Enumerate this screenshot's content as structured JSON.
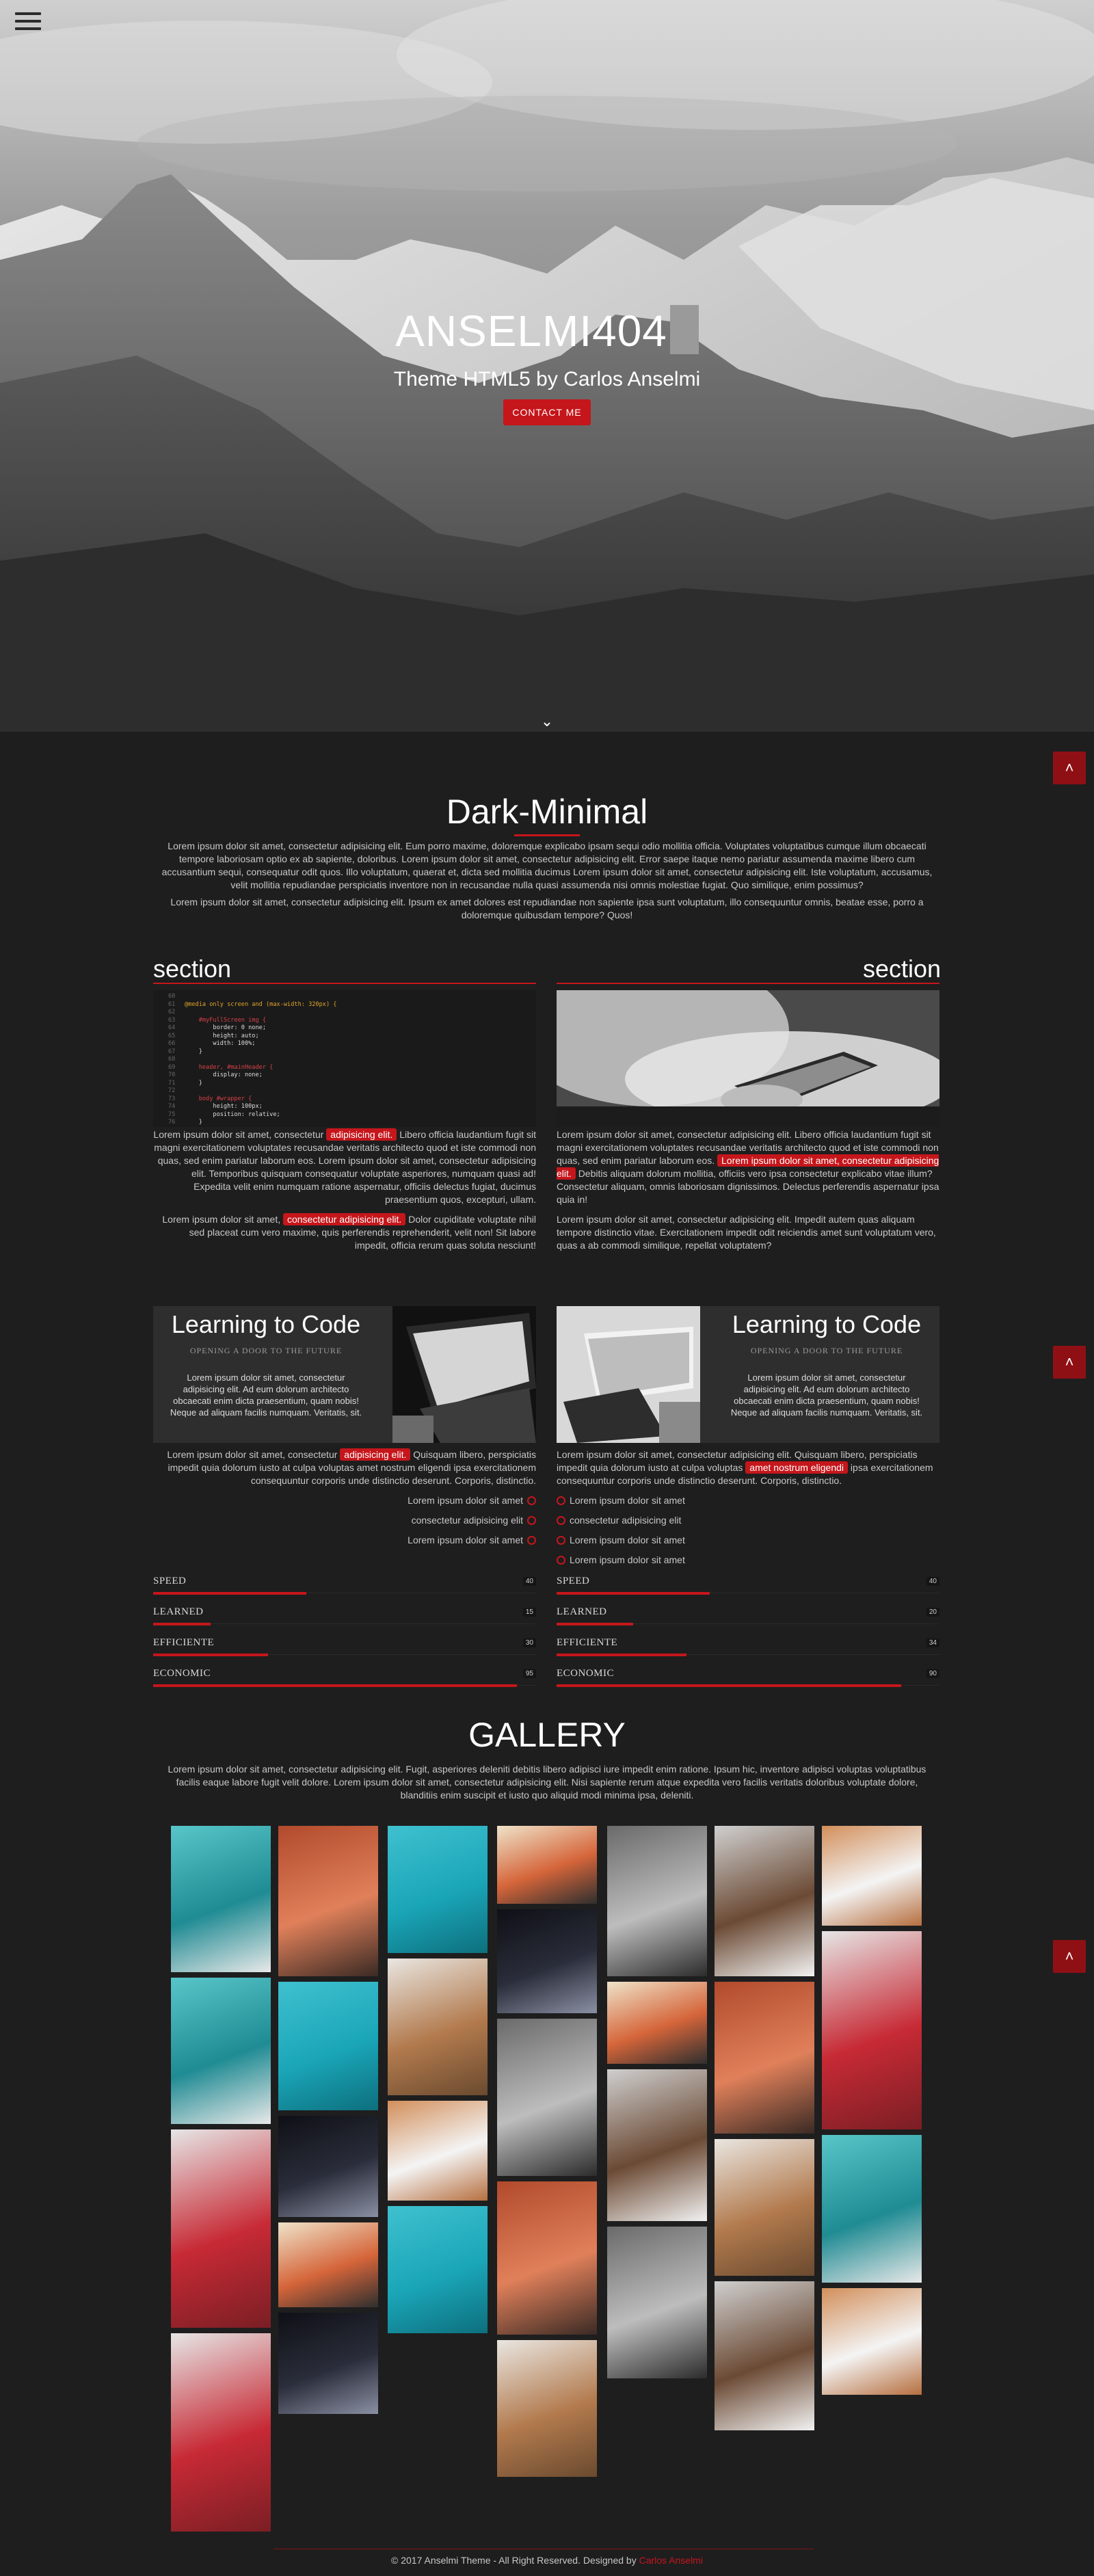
{
  "hero": {
    "title": "ANSELMI404",
    "subtitle": "Theme HTML5 by Carlos Anselmi",
    "contact_label": "CONTACT ME",
    "scroll_icon": "chevron-down-icon"
  },
  "side_buttons": {
    "icon": "chevron-up-icon",
    "label": "^"
  },
  "intro": {
    "title": "Dark-Minimal",
    "para1": "Lorem ipsum dolor sit amet, consectetur adipisicing elit. Eum porro maxime, doloremque explicabo ipsam sequi odio mollitia officia. Voluptates voluptatibus cumque illum obcaecati tempore laboriosam optio ex ab sapiente, doloribus. Lorem ipsum dolor sit amet, consectetur adipisicing elit. Error saepe itaque nemo pariatur assumenda maxime libero cum accusantium sequi, consequatur odit quos. Illo voluptatum, quaerat et, dicta sed mollitia ducimus Lorem ipsum dolor sit amet, consectetur adipisicing elit. Iste voluptatum, accusamus, velit mollitia repudiandae perspiciatis inventore non in recusandae nulla quasi assumenda nisi omnis molestiae fugiat. Quo similique, enim possimus?",
    "para2": "Lorem ipsum dolor sit amet, consectetur adipisicing elit. Ipsum ex amet dolores est repudiandae non sapiente ipsa sunt voluptatum, illo consequuntur omnis, beatae esse, porro a doloremque quibusdam tempore? Quos!"
  },
  "sections": {
    "left": {
      "heading": "section",
      "p1_a": "Lorem ipsum dolor sit amet, consectetur",
      "p1_hl": "adipisicing elit.",
      "p1_b": "Libero officia laudantium fugit sit magni exercitationem voluptates recusandae veritatis architecto quod et iste commodi non quas, sed enim pariatur laborum eos. Lorem ipsum dolor sit amet, consectetur adipisicing elit. Temporibus quisquam consequatur voluptate asperiores, numquam quasi ad! Expedita velit enim numquam ratione aspernatur, officiis delectus fugiat, ducimus praesentium quos, excepturi, ullam.",
      "p2_a": "Lorem ipsum dolor sit amet,",
      "p2_hl": "consectetur adipisicing elit.",
      "p2_b": "Dolor cupiditate voluptate nihil sed placeat cum vero maxime, quis perferendis reprehenderit, velit non! Sit labore impedit, officia rerum quas soluta nesciunt!"
    },
    "right": {
      "heading": "section",
      "p1_a": "Lorem ipsum dolor sit amet, consectetur adipisicing elit. Libero officia laudantium fugit sit magni exercitationem voluptates recusandae veritatis architecto quod et iste commodi non quas, sed enim pariatur laborum eos.",
      "p1_hl": "Lorem ipsum dolor sit amet, consectetur adipisicing elit.",
      "p1_b": "Debitis aliquam dolorum mollitia, officiis vero ipsa consectetur explicabo vitae illum? Consectetur aliquam, omnis laboriosam dignissimos. Delectus perferendis aspernatur ipsa quia in!",
      "p2": "Lorem ipsum dolor sit amet, consectetur adipisicing elit. Impedit autem quas aliquam tempore distinctio vitae. Exercitationem impedit odit reiciendis amet sunt voluptatum vero, quas a ab commodi similique, repellat voluptatem?"
    }
  },
  "code": {
    "line_numbers": [
      "60",
      "61",
      "62",
      "63",
      "64",
      "65",
      "66",
      "67",
      "68",
      "69",
      "70",
      "71",
      "72",
      "73",
      "74",
      "75",
      "76",
      "77"
    ],
    "lines": [
      "",
      "@media only screen and (max-width: 320px) {",
      "",
      "    #myFullScreen img {",
      "        border: 0 none;",
      "        height: auto;",
      "        width: 100%;",
      "    }",
      "",
      "    header, #mainHeader {",
      "        display: none;",
      "    }",
      "",
      "    body #wrapper {",
      "        height: 100px;",
      "        position: relative;",
      "    }",
      ""
    ]
  },
  "cards": [
    {
      "title": "Learning to Code",
      "tagline": "OPENING A DOOR TO THE FUTURE",
      "body": "Lorem ipsum dolor sit amet, consectetur adipisicing elit. Ad eum dolorum architecto obcaecati enim dicta praesentium, quam nobis! Neque ad aliquam facilis numquam. Veritatis, sit."
    },
    {
      "title": "Learning to Code",
      "tagline": "OPENING A DOOR TO THE FUTURE",
      "body": "Lorem ipsum dolor sit amet, consectetur adipisicing elit. Ad eum dolorum architecto obcaecati enim dicta praesentium, quam nobis! Neque ad aliquam facilis numquam. Veritatis, sit."
    }
  ],
  "card_paras": {
    "left_a": "Lorem ipsum dolor sit amet, consectetur",
    "left_hl": "adipisicing elit.",
    "left_b": "Quisquam libero, perspiciatis impedit quia dolorum iusto at culpa voluptas amet nostrum eligendi ipsa exercitationem consequuntur corporis unde distinctio deserunt. Corporis, distinctio.",
    "right_a": "Lorem ipsum dolor sit amet, consectetur adipisicing elit. Quisquam libero, perspiciatis impedit quia dolorum iusto at culpa voluptas",
    "right_hl": "amet nostrum eligendi",
    "right_b": "ipsa exercitationem consequuntur corporis unde distinctio deserunt. Corporis, distinctio."
  },
  "lists": {
    "left": [
      "Lorem ipsum dolor sit amet",
      "consectetur adipisicing elit",
      "Lorem ipsum dolor sit amet"
    ],
    "right": [
      "Lorem ipsum dolor sit amet",
      "consectetur adipisicing elit",
      "Lorem ipsum dolor sit amet",
      "Lorem ipsum dolor sit amet"
    ]
  },
  "skills": {
    "left": [
      {
        "label": "SPEED",
        "value": "40"
      },
      {
        "label": "LEARNED",
        "value": "15"
      },
      {
        "label": "EFFICIENTE",
        "value": "30"
      },
      {
        "label": "ECONOMIC",
        "value": "95"
      }
    ],
    "right": [
      {
        "label": "SPEED",
        "value": "40"
      },
      {
        "label": "LEARNED",
        "value": "20"
      },
      {
        "label": "EFFICIENTE",
        "value": "34"
      },
      {
        "label": "ECONOMIC",
        "value": "90"
      }
    ]
  },
  "gallery": {
    "title": "GALLERY",
    "desc": "Lorem ipsum dolor sit amet, consectetur adipisicing elit. Fugit, asperiores deleniti debitis libero adipisci iure impedit enim ratione. Ipsum hic, inventore adipisci voluptas voluptatibus facilis eaque labore fugit velit dolore. Lorem ipsum dolor sit amet, consectetur adipisicing elit. Nisi sapiente rerum atque expedita vero facilis veritatis doloribus voluptate dolore, blanditiis enim suscipit et iusto quo aliquid modi minima ipsa, deleniti."
  },
  "footer": {
    "text": "© 2017 Anselmi Theme - All Right Reserved. Designed by",
    "author": "Carlos Anselmi"
  },
  "colors": {
    "accent": "#c5161b",
    "background": "#1e1e1f"
  }
}
